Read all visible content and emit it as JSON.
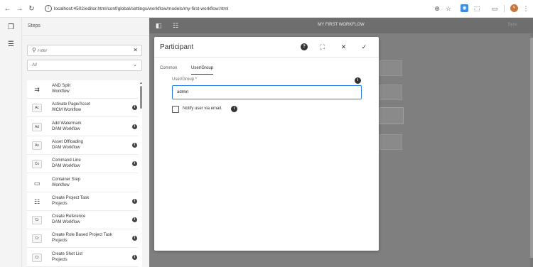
{
  "browser": {
    "url": "localhost:4502/editor.html/conf/global/settings/workflow/models/my-first-workflow.html",
    "profile_initial": "v"
  },
  "sidebar": {
    "title": "Steps",
    "filter_placeholder": "Filter",
    "group_select": "All",
    "items": [
      {
        "icon": "split-icon",
        "badge": "",
        "name": "AND Split",
        "group": "Workflow",
        "info": false
      },
      {
        "icon": "",
        "badge": "Ac",
        "name": "Activate Page/Asset",
        "group": "WCM Workflow",
        "info": true
      },
      {
        "icon": "",
        "badge": "Ad",
        "name": "Add Watermark",
        "group": "DAM Workflow",
        "info": true
      },
      {
        "icon": "",
        "badge": "As",
        "name": "Asset Offloading",
        "group": "DAM Workflow",
        "info": true
      },
      {
        "icon": "",
        "badge": "Co",
        "name": "Command Line",
        "group": "DAM Workflow",
        "info": true
      },
      {
        "icon": "container-icon",
        "badge": "",
        "name": "Container Step",
        "group": "Workflow",
        "info": false
      },
      {
        "icon": "project-task-icon",
        "badge": "",
        "name": "Create Project Task",
        "group": "Projects",
        "info": true
      },
      {
        "icon": "",
        "badge": "Cr",
        "name": "Create Reference",
        "group": "DAM Workflow",
        "info": true
      },
      {
        "icon": "",
        "badge": "Cr",
        "name": "Create Role Based Project Task",
        "group": "Projects",
        "info": true
      },
      {
        "icon": "",
        "badge": "Cr",
        "name": "Create Shot List",
        "group": "Projects",
        "info": true
      }
    ]
  },
  "editor": {
    "title": "MY FIRST WORKFLOW",
    "sync_label": "Sync"
  },
  "dialog": {
    "title": "Participant",
    "tabs": [
      "Common",
      "User/Group"
    ],
    "active_tab": "User/Group",
    "field_label": "User/Group *",
    "field_value": "admin",
    "checkbox_label": "Notify user via email.",
    "checkbox_checked": false
  },
  "colors": {
    "accent": "#2680eb",
    "overlay": "#7f7f7f"
  }
}
